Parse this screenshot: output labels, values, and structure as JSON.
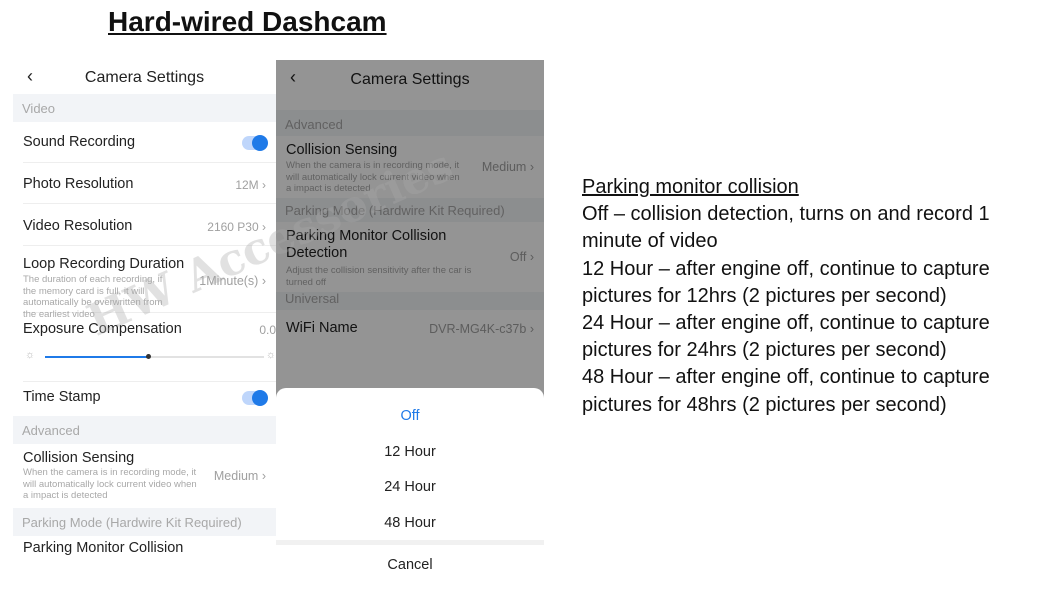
{
  "title": "Hard-wired Dashcam",
  "watermark": "HW Accessories",
  "left_screen": {
    "back_icon": "chevron-left-icon",
    "nav_title": "Camera Settings",
    "section_video": "Video",
    "sound_recording": "Sound Recording",
    "sound_recording_on": true,
    "photo_resolution": "Photo Resolution",
    "photo_resolution_value": "12M",
    "video_resolution": "Video Resolution",
    "video_resolution_value": "2160 P30",
    "loop_recording": "Loop Recording Duration",
    "loop_recording_desc": "The duration of each recording, if the memory card is full, it will automatically be overwritten from the earliest video",
    "loop_recording_value": "1Minute(s)",
    "exposure": "Exposure Compensation",
    "exposure_value": "0.0",
    "exposure_level_percent": 47,
    "time_stamp": "Time Stamp",
    "time_stamp_on": true,
    "section_advanced": "Advanced",
    "collision_sensing": "Collision Sensing",
    "collision_sensing_desc": "When the camera is in recording mode, it will automatically lock current video when a impact is detected",
    "collision_sensing_value": "Medium",
    "section_parking": "Parking Mode (Hardwire Kit Required)",
    "parking_monitor": "Parking Monitor Collision"
  },
  "right_screen": {
    "nav_title": "Camera Settings",
    "section_advanced": "Advanced",
    "collision_sensing": "Collision Sensing",
    "collision_sensing_desc": "When the camera is in recording mode, it will automatically lock current video when a impact is detected",
    "collision_sensing_value": "Medium",
    "section_parking": "Parking Mode (Hardwire Kit Required)",
    "parking_monitor": "Parking Monitor Collision Detection",
    "parking_monitor_desc": "Adjust the collision sensitivity after the car is turned off",
    "parking_monitor_value": "Off",
    "section_universal": "Universal",
    "wifi_name": "WiFi Name",
    "wifi_name_value": "DVR-MG4K-c37b",
    "options": [
      "Off",
      "12 Hour",
      "24 Hour",
      "48 Hour"
    ],
    "selected_option": "Off",
    "cancel": "Cancel"
  },
  "notes": {
    "header": "Parking monitor collision",
    "lines": [
      "Off –  collision detection, turns on and record 1 minute of video",
      "12 Hour –  after engine off, continue to capture pictures for 12hrs (2 pictures per second)",
      "24 Hour –  after engine off, continue to capture pictures for 24hrs (2 pictures per second)",
      "48 Hour –  after engine off, continue to capture pictures for 48hrs (2 pictures per second)"
    ]
  },
  "colors": {
    "accent": "#1f7ae8",
    "section_bg": "#f2f4f7"
  }
}
